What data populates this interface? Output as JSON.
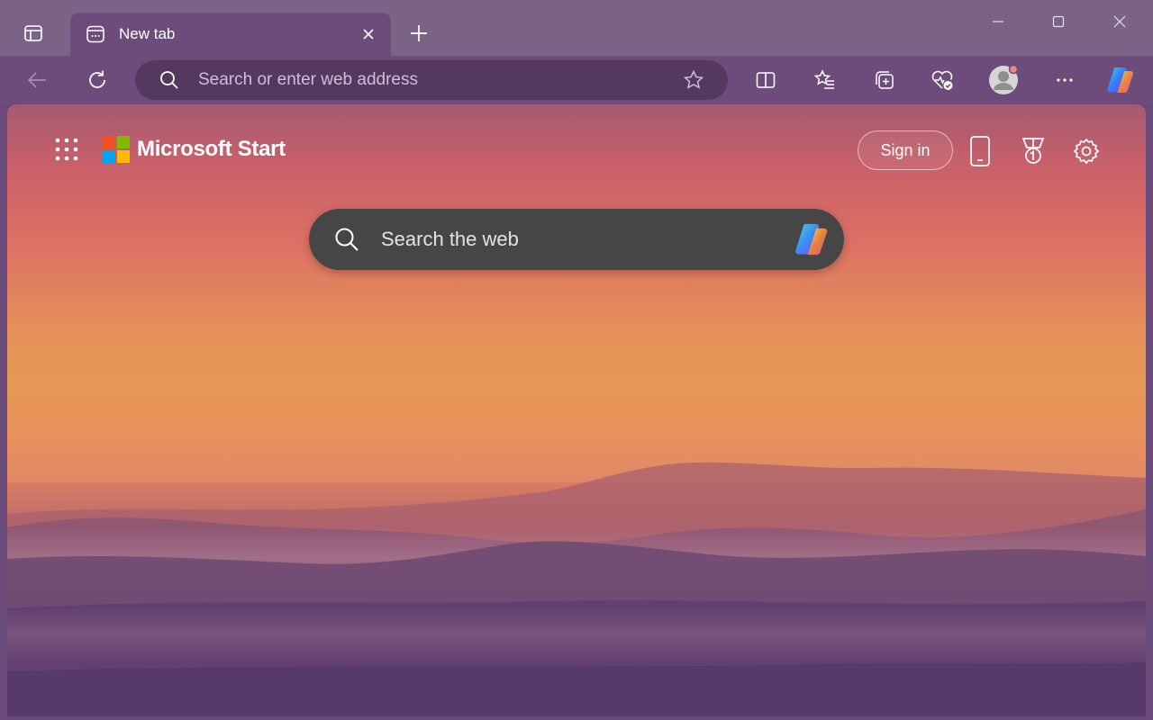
{
  "titlebar": {
    "tab": {
      "title": "New tab",
      "favicon": "newtab-page-icon"
    },
    "icons": {
      "tab_actions": "tab-actions-icon",
      "close_tab": "close-icon",
      "new_tab": "plus-icon",
      "minimize": "minimize-icon",
      "maximize": "maximize-icon",
      "close_window": "close-icon"
    }
  },
  "toolbar": {
    "address_placeholder": "Search or enter web address",
    "icons": [
      "back-arrow-icon",
      "refresh-icon",
      "search-icon",
      "star-icon",
      "split-screen-icon",
      "favorites-icon",
      "collections-icon",
      "browser-essentials-icon",
      "profile-avatar-icon",
      "more-icon",
      "copilot-icon"
    ]
  },
  "newtab": {
    "brand": "Microsoft Start",
    "sign_in": "Sign in",
    "search_placeholder": "Search the web",
    "icons": [
      "apps-launcher-icon",
      "phone-icon",
      "rewards-icon",
      "settings-icon",
      "search-icon",
      "copilot-icon"
    ]
  },
  "colors": {
    "titlebar_bg": "#7a6384",
    "toolbar_bg": "#6d4b7b",
    "address_bg": "#54385f",
    "search_box_bg": "#464646",
    "ms_red": "#f25022",
    "ms_green": "#7fba00",
    "ms_blue": "#00a4ef",
    "ms_yellow": "#ffb900"
  }
}
